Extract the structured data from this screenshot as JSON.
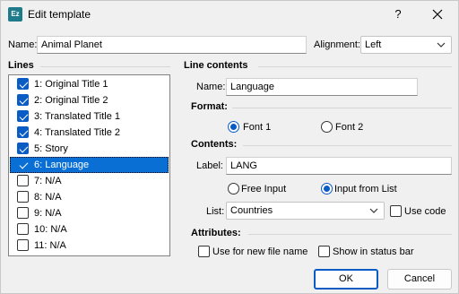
{
  "window": {
    "title": "Edit template",
    "app_icon": "Ez",
    "help": "?"
  },
  "top": {
    "name_label": "Name:",
    "name_value": "Animal Planet",
    "alignment_label": "Alignment:",
    "alignment_value": "Left"
  },
  "lines": {
    "heading": "Lines",
    "items": [
      {
        "label": "1: Original Title 1",
        "checked": true
      },
      {
        "label": "2: Original Title 2",
        "checked": true
      },
      {
        "label": "3: Translated Title 1",
        "checked": true
      },
      {
        "label": "4: Translated Title 2",
        "checked": true
      },
      {
        "label": "5: Story",
        "checked": true
      },
      {
        "label": "6: Language",
        "checked": true,
        "selected": true
      },
      {
        "label": "7: N/A",
        "checked": false
      },
      {
        "label": "8: N/A",
        "checked": false
      },
      {
        "label": "9: N/A",
        "checked": false
      },
      {
        "label": "10: N/A",
        "checked": false
      },
      {
        "label": "11: N/A",
        "checked": false
      }
    ]
  },
  "contents": {
    "heading": "Line contents",
    "name_label": "Name:",
    "name_value": "Language",
    "format_heading": "Format:",
    "font1": "Font 1",
    "font2": "Font 2",
    "font_selected": "Font 1",
    "contents_heading": "Contents:",
    "label_label": "Label:",
    "label_value": "LANG",
    "free_input": "Free Input",
    "input_from_list": "Input from List",
    "input_selected": "Input from List",
    "list_label": "List:",
    "list_value": "Countries",
    "use_code": "Use code",
    "attributes_heading": "Attributes:",
    "use_for_new_file_name": "Use for new file name",
    "show_in_status_bar": "Show in status bar"
  },
  "buttons": {
    "ok": "OK",
    "cancel": "Cancel"
  },
  "colors": {
    "accent": "#0a5bc4",
    "selection": "#0a6fd4",
    "app_icon": "#1f7a8c"
  }
}
